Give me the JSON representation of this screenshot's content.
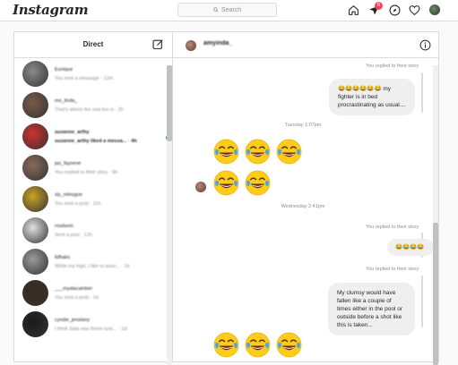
{
  "topbar": {
    "logo": "Instagram",
    "search_placeholder": "Search",
    "notification_count": "6"
  },
  "direct": {
    "title": "Direct",
    "conversations": [
      {
        "name": "Eunique",
        "last": "You sent a message · 12m",
        "avatar_color": "#8a8a8a",
        "unread": false
      },
      {
        "name": "mo_linda_",
        "last": "That's where the real fun is · 2h",
        "avatar_color": "#7a5a4a",
        "unread": false
      },
      {
        "name": "suzanne_arthy",
        "last": "suzanne_arthy liked a messa... · 4h",
        "avatar_color": "#d0312d",
        "unread": true
      },
      {
        "name": "jas_faysene",
        "last": "You replied to their story · 5h",
        "avatar_color": "#8a6a5a",
        "unread": false
      },
      {
        "name": "sly_mlnugue",
        "last": "You sent a post · 11h",
        "avatar_color": "#c9a227",
        "unread": false
      },
      {
        "name": "rosdavin",
        "last": "Sent a post · 12h",
        "avatar_color": "#e0e0e0",
        "unread": false
      },
      {
        "name": "lidhaks",
        "last": "While my high, I like to wast... · 1d",
        "avatar_color": "#9a9a9a",
        "unread": false
      },
      {
        "name": "___myalacamber",
        "last": "You sent a post · 1d",
        "avatar_color": "#3a2a20",
        "unread": false
      },
      {
        "name": "cyndie_jenslany",
        "last": "I think Sala was these isns... · 1d",
        "avatar_color": "#1a1a1a",
        "unread": false
      }
    ]
  },
  "chat": {
    "username": "amyinda_",
    "replied_label": "You replied to their story",
    "msg1_emojis": "😂😂😂😂😂😂",
    "msg1_text": " my fighter is in bed procrastinating as usual....",
    "ts1": "Tuesday 1:07pm",
    "ts2": "Wednesday 2:41pm",
    "msg2": "😂😂😂😂",
    "msg3": "My clumsy would have fallen like a couple of times either in the pool or outside before a shot like this is taken...",
    "emoji_color": "#ffcc1a"
  }
}
